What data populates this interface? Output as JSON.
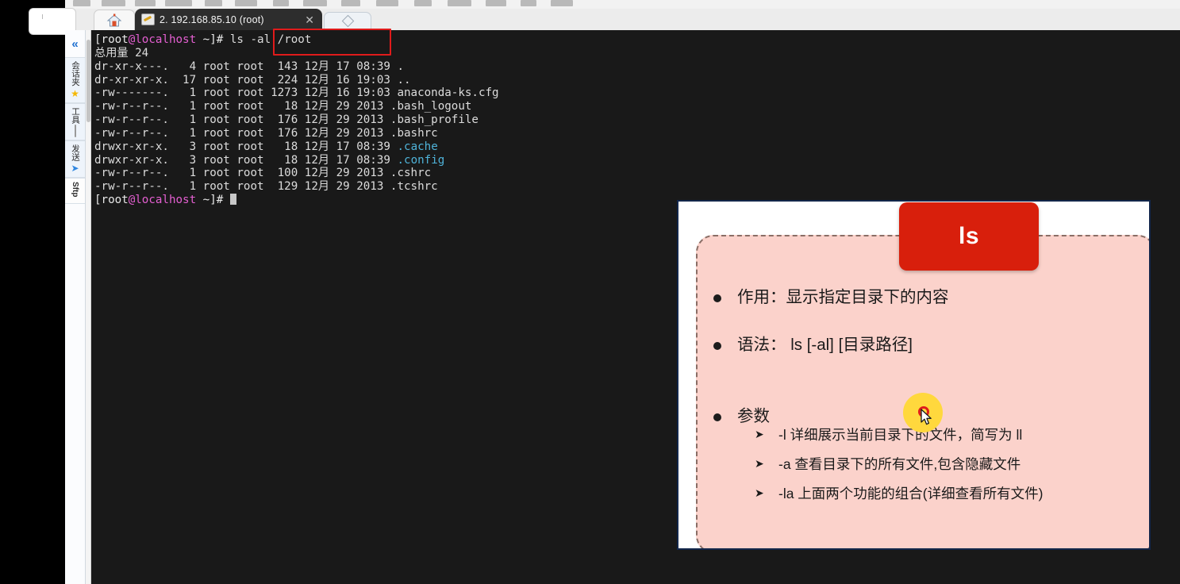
{
  "window": {
    "tabs": [
      {
        "label": "",
        "icon": "home-icon",
        "active": false
      },
      {
        "label": "2. 192.168.85.10 (root)",
        "icon": "terminal-key-icon",
        "active": true
      },
      {
        "label": "",
        "icon": "diamond-icon",
        "active": false
      }
    ],
    "close_glyph": "✕"
  },
  "rail": {
    "collapse_glyph": "«",
    "items": [
      {
        "label": "会话夹",
        "icon": "star-icon",
        "icon_glyph": "★"
      },
      {
        "label": "工具",
        "icon": "thermometer-icon",
        "icon_glyph": ""
      },
      {
        "label": "发送",
        "icon": "paper-plane-icon",
        "icon_glyph": "➤"
      },
      {
        "label": "Sftp",
        "icon": "globe-icon",
        "icon_glyph": ""
      }
    ]
  },
  "terminal": {
    "prompt_user": "[root",
    "prompt_host": "@localhost",
    "prompt_tail": " ~]# ",
    "command": "ls -al /root",
    "total_line": "总用量 24",
    "rows": [
      {
        "perm": "dr-xr-x---.",
        "links": "  4",
        "owner": "root",
        "group": "root",
        "size": " 143",
        "month": "12月",
        "day": "17",
        "time": "08:39",
        "name": ".",
        "is_dir": false
      },
      {
        "perm": "dr-xr-xr-x.",
        "links": " 17",
        "owner": "root",
        "group": "root",
        "size": " 224",
        "month": "12月",
        "day": "16",
        "time": "19:03",
        "name": "..",
        "is_dir": false
      },
      {
        "perm": "-rw-------.",
        "links": "  1",
        "owner": "root",
        "group": "root",
        "size": "1273",
        "month": "12月",
        "day": "16",
        "time": "19:03",
        "name": "anaconda-ks.cfg",
        "is_dir": false
      },
      {
        "perm": "-rw-r--r--.",
        "links": "  1",
        "owner": "root",
        "group": "root",
        "size": "  18",
        "month": "12月",
        "day": "29",
        "time": "2013",
        "name": ".bash_logout",
        "is_dir": false
      },
      {
        "perm": "-rw-r--r--.",
        "links": "  1",
        "owner": "root",
        "group": "root",
        "size": " 176",
        "month": "12月",
        "day": "29",
        "time": "2013",
        "name": ".bash_profile",
        "is_dir": false
      },
      {
        "perm": "-rw-r--r--.",
        "links": "  1",
        "owner": "root",
        "group": "root",
        "size": " 176",
        "month": "12月",
        "day": "29",
        "time": "2013",
        "name": ".bashrc",
        "is_dir": false
      },
      {
        "perm": "drwxr-xr-x.",
        "links": "  3",
        "owner": "root",
        "group": "root",
        "size": "  18",
        "month": "12月",
        "day": "17",
        "time": "08:39",
        "name": ".cache",
        "is_dir": true
      },
      {
        "perm": "drwxr-xr-x.",
        "links": "  3",
        "owner": "root",
        "group": "root",
        "size": "  18",
        "month": "12月",
        "day": "17",
        "time": "08:39",
        "name": ".config",
        "is_dir": true
      },
      {
        "perm": "-rw-r--r--.",
        "links": "  1",
        "owner": "root",
        "group": "root",
        "size": " 100",
        "month": "12月",
        "day": "29",
        "time": "2013",
        "name": ".cshrc",
        "is_dir": false
      },
      {
        "perm": "-rw-r--r--.",
        "links": "  1",
        "owner": "root",
        "group": "root",
        "size": " 129",
        "month": "12月",
        "day": "29",
        "time": "2013",
        "name": ".tcshrc",
        "is_dir": false
      }
    ]
  },
  "slide": {
    "badge": "ls",
    "bullets": [
      "作用：显示指定目录下的内容",
      "语法： ls [-al] [目录路径]",
      "参数"
    ],
    "params": [
      "-l  详细展示当前目录下的文件，简写为 ll",
      "-a  查看目录下的所有文件,包含隐藏文件",
      "-la 上面两个功能的组合(详细查看所有文件)"
    ],
    "arrow_glyph": "➤"
  },
  "colors": {
    "accent_red": "#e01b1b",
    "badge_red": "#d81f0c",
    "slide_border": "#12264a",
    "pink_bg": "#fbd2cb",
    "terminal_bg": "#191919",
    "prompt_host": "#e45fd1",
    "dir_color": "#4fb3d9",
    "click_highlight": "#ffd83d"
  }
}
